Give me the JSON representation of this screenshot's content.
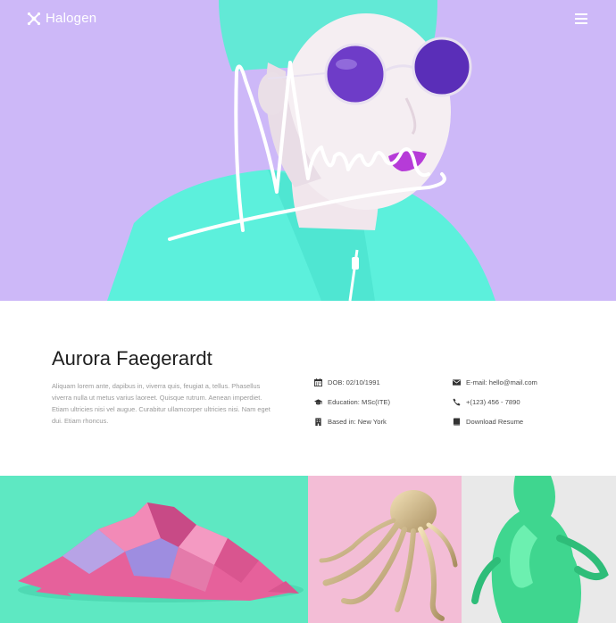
{
  "brand": {
    "name": "Halogen",
    "logo_icon": "snowflake-logo-icon"
  },
  "header": {
    "menu_icon": "hamburger-menu-icon"
  },
  "hero": {
    "background_color": "#cdb8f8",
    "accent_color": "#5cf0dc",
    "image": "portrait-with-signature"
  },
  "profile": {
    "name": "Aurora Faegerardt",
    "bio": "Aliquam lorem ante, dapibus in, viverra quis, feugiat a, tellus. Phasellus viverra nulla ut metus varius laoreet. Quisque rutrum. Aenean imperdiet. Etiam ultricies nisi vel augue. Curabitur ullamcorper ultricies nisi. Nam eget dui. Etiam rhoncus.",
    "details": {
      "dob": "DOB: 02/10/1991",
      "education": "Education: MSc(ITE)",
      "location": "Based in: New York",
      "email": "E-mail: hello@mail.com",
      "phone": "+(123) 456 - 7890",
      "resume": "Download Resume"
    }
  },
  "gallery": {
    "tiles": [
      {
        "image": "pink-lowpoly-mountain",
        "background_color": "#5ee8c2"
      },
      {
        "image": "gold-octopus",
        "background_color": "#f6a9c9"
      },
      {
        "image": "green-figure",
        "background_color": "#e9e9e9"
      }
    ]
  }
}
